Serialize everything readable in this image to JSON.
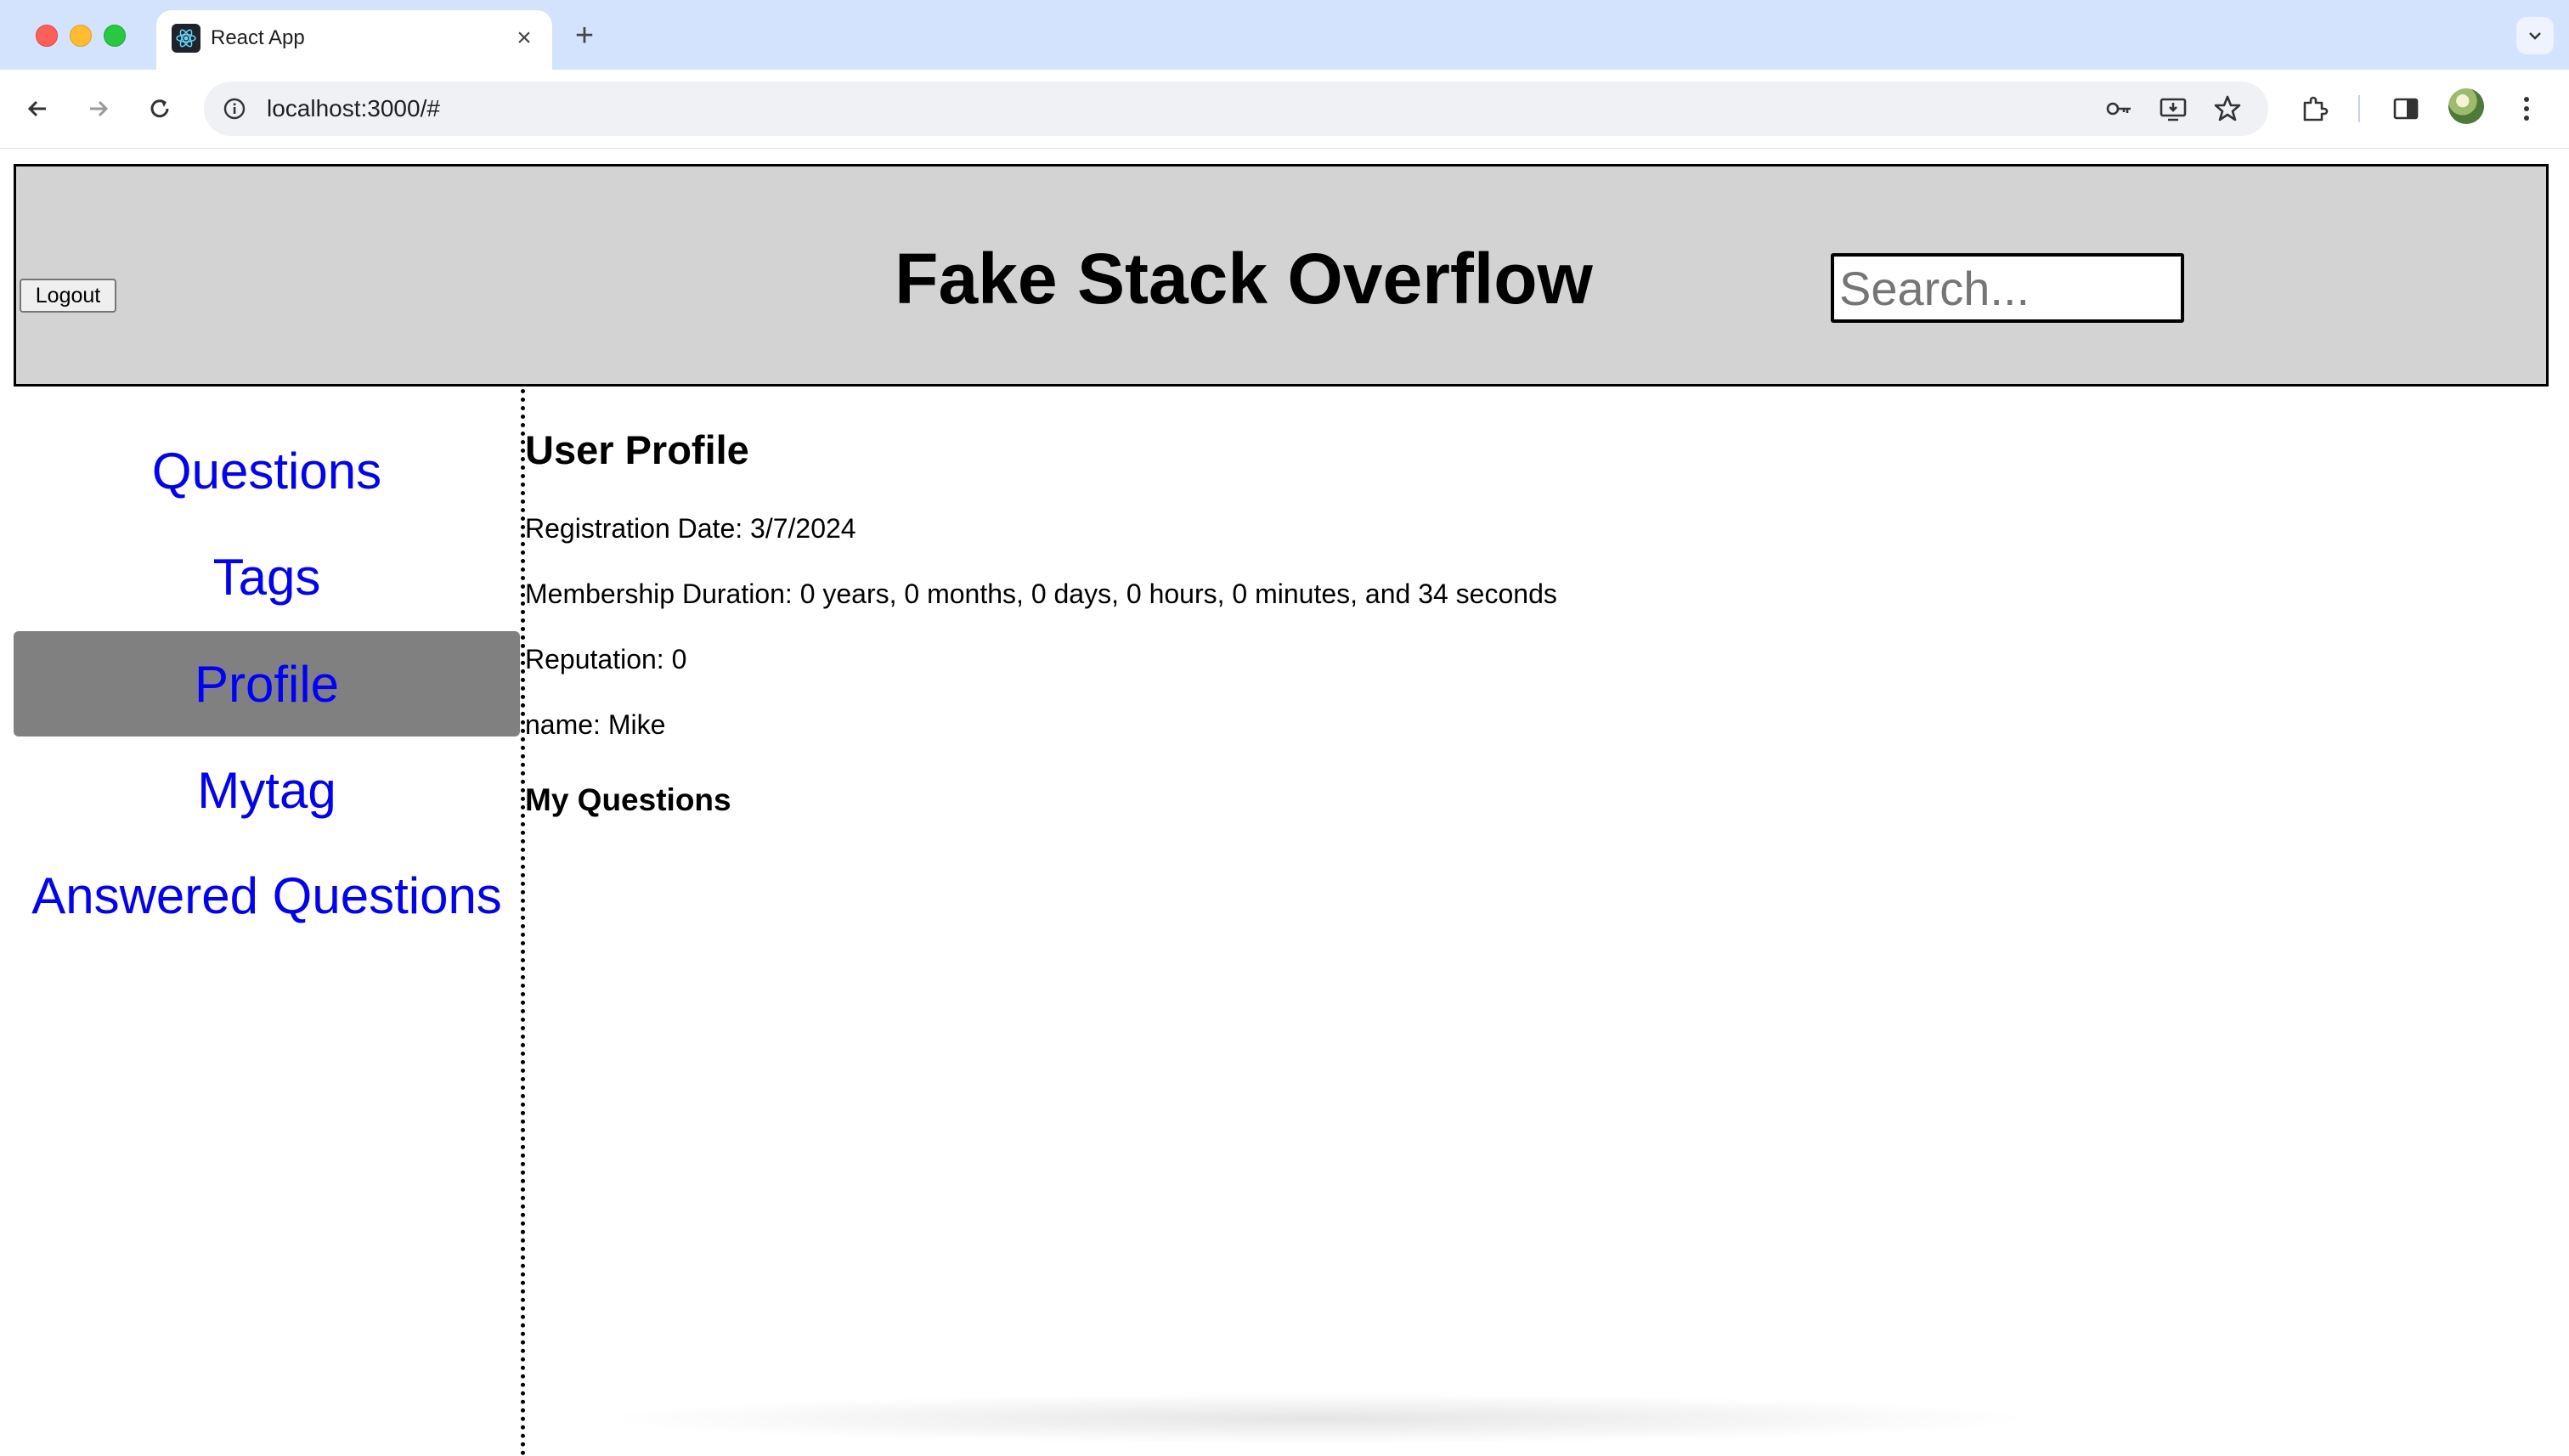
{
  "browser": {
    "tab_title": "React App",
    "url": "localhost:3000/#",
    "accent": "#d3e3fd"
  },
  "header": {
    "title": "Fake Stack Overflow",
    "logout_label": "Logout",
    "search_placeholder": "Search..."
  },
  "sidebar": {
    "items": [
      {
        "label": "Questions",
        "active": false
      },
      {
        "label": "Tags",
        "active": false
      },
      {
        "label": "Profile",
        "active": true
      },
      {
        "label": "Mytag",
        "active": false
      },
      {
        "label": "Answered Questions",
        "active": false
      }
    ],
    "link_color": "#0000ff",
    "active_bg": "#808080"
  },
  "profile": {
    "title": "User Profile",
    "registration": "Registration Date: 3/7/2024",
    "membership": "Membership Duration: 0 years, 0 months, 0 days, 0 hours, 0 minutes, and 34 seconds",
    "reputation": "Reputation: 0",
    "name": "name: Mike",
    "my_questions_title": "My Questions"
  }
}
